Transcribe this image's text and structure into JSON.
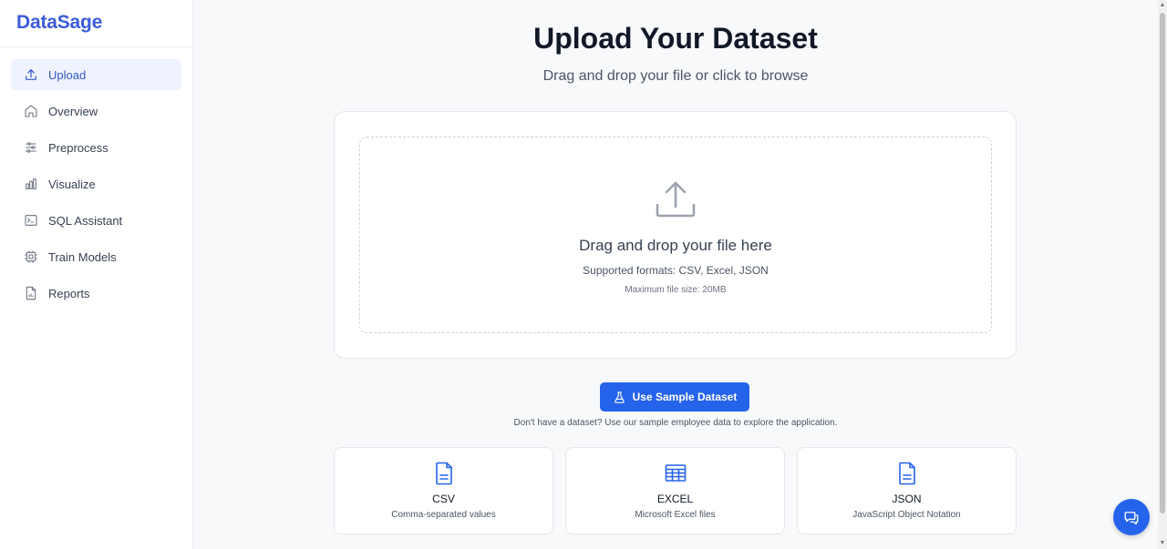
{
  "app": {
    "name": "DataSage",
    "brand_color": "#3b5bdb",
    "accent_color": "#2563eb"
  },
  "sidebar": {
    "items": [
      {
        "label": "Upload",
        "icon": "upload-icon",
        "active": true
      },
      {
        "label": "Overview",
        "icon": "home-icon"
      },
      {
        "label": "Preprocess",
        "icon": "sliders-icon"
      },
      {
        "label": "Visualize",
        "icon": "bar-chart-icon"
      },
      {
        "label": "SQL Assistant",
        "icon": "terminal-icon"
      },
      {
        "label": "Train Models",
        "icon": "cpu-icon"
      },
      {
        "label": "Reports",
        "icon": "file-chart-icon"
      }
    ]
  },
  "main": {
    "title": "Upload Your Dataset",
    "subtitle": "Drag and drop your file or click to browse",
    "dropzone": {
      "icon": "upload-icon",
      "heading": "Drag and drop your file here",
      "formats": "Supported formats: CSV, Excel, JSON",
      "max_size": "Maximum file size: 20MB"
    },
    "sample_button": {
      "label": "Use Sample Dataset",
      "icon": "flask-icon"
    },
    "hint": "Don't have a dataset? Use our sample employee data to explore the application.",
    "format_cards": [
      {
        "name": "CSV",
        "description": "Comma-separated values",
        "icon": "file-text-icon"
      },
      {
        "name": "EXCEL",
        "description": "Microsoft Excel files",
        "icon": "table-icon"
      },
      {
        "name": "JSON",
        "description": "JavaScript Object Notation",
        "icon": "file-text-icon"
      }
    ]
  },
  "chat_button": {
    "icon": "chat-icon"
  }
}
